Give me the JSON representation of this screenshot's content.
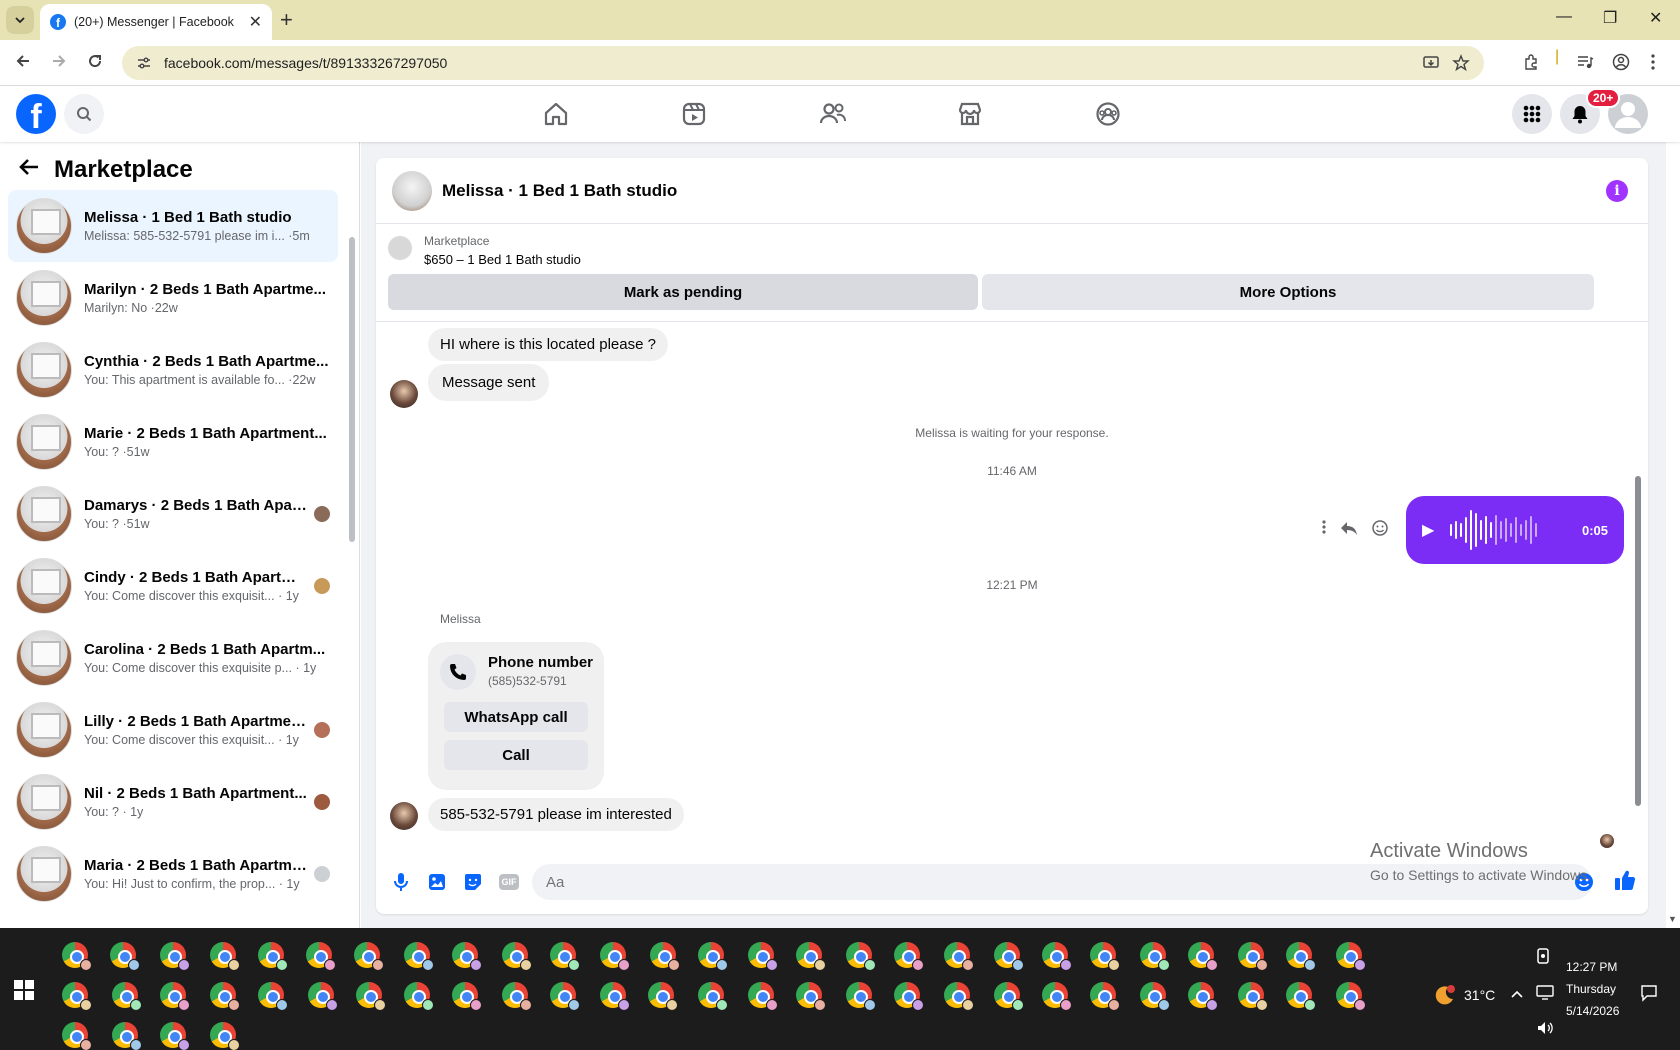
{
  "browser": {
    "tab_title": "(20+) Messenger | Facebook",
    "url": "facebook.com/messages/t/891333267297050",
    "new_tab": "+",
    "close": "✕",
    "minimize": "—",
    "restore": "❐",
    "window_close": "✕"
  },
  "header": {
    "notification_badge": "20+",
    "fb_letter": "f"
  },
  "left": {
    "title": "Marketplace",
    "conversations": [
      {
        "name": "Melissa · 1 Bed 1 Bath studio",
        "snippet": "Melissa: 585-532-5791 please im i... ·5m"
      },
      {
        "name": "Marilyn · 2 Beds 1 Bath Apartme...",
        "snippet": "Marilyn: No ·22w"
      },
      {
        "name": "Cynthia · 2 Beds 1 Bath Apartme...",
        "snippet": "You: This apartment is available fo... ·22w"
      },
      {
        "name": "Marie · 2 Beds 1 Bath Apartment...",
        "snippet": "You: ? ·51w"
      },
      {
        "name": "Damarys · 2 Beds 1 Bath Apart...",
        "snippet": "You: ? ·51w"
      },
      {
        "name": "Cindy · 2 Beds 1 Bath Apartme...",
        "snippet": "You: Come discover this exquisit... · 1y"
      },
      {
        "name": "Carolina · 2 Beds 1 Bath Apartm...",
        "snippet": "You: Come discover this exquisite p... · 1y"
      },
      {
        "name": "Lilly · 2 Beds 1 Bath Apartmen...",
        "snippet": "You: Come discover this exquisit... · 1y"
      },
      {
        "name": "Nil · 2 Beds 1 Bath Apartment...",
        "snippet": "You: ? · 1y"
      },
      {
        "name": "Maria · 2 Beds 1 Bath Apartme...",
        "snippet": "You: Hi! Just to confirm, the prop... · 1y"
      }
    ]
  },
  "chat": {
    "title": "Melissa · 1 Bed 1 Bath studio",
    "marketplace_label": "Marketplace",
    "listing": "$650 – 1 Bed 1 Bath studio",
    "mark_pending": "Mark as pending",
    "more_options": "More Options",
    "msg_location": "HI where is this located please  ?",
    "msg_sent": "Message sent",
    "waiting": "Melissa is waiting for your response.",
    "time1": "11:46 AM",
    "voice_duration": "0:05",
    "time2": "12:21 PM",
    "sender": "Melissa",
    "phone_title": "Phone number",
    "phone_number": "(585)532-5791",
    "whatsapp_call": "WhatsApp call",
    "call": "Call",
    "last_msg": "585-532-5791 please im interested",
    "composer_placeholder": "Aa",
    "gif": "GIF"
  },
  "watermark": {
    "line1": "Activate Windows",
    "line2": "Go to Settings to activate Windows."
  },
  "taskbar": {
    "temp": "31°C",
    "time": "12:27 PM",
    "day": "Thursday",
    "date": "5/14/2026"
  }
}
